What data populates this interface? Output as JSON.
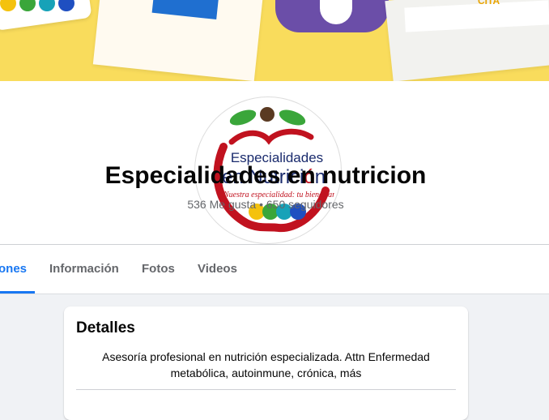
{
  "cover": {
    "text": "CITA"
  },
  "profile": {
    "logo": {
      "line1": "Especialidades",
      "line2": "en Nutrici",
      "line2_end": "n",
      "tagline": "Nuestra especialidad: tu bienestar"
    },
    "name": "Especialidades en nutricion",
    "stats": "536 Me gusta • 650 seguidores"
  },
  "tabs": [
    {
      "label": "ones",
      "active": true
    },
    {
      "label": "Información"
    },
    {
      "label": "Fotos"
    },
    {
      "label": "Videos"
    }
  ],
  "details": {
    "title": "Detalles",
    "description": "Asesoría profesional en nutrición especializada. Attn Enfermedad metabólica, autoinmune, crónica, más"
  },
  "colors": {
    "accent": "#1877f2",
    "logo_red": "#c1121f",
    "logo_green": "#3aa63a",
    "cover_yellow": "#f9dc5c"
  }
}
